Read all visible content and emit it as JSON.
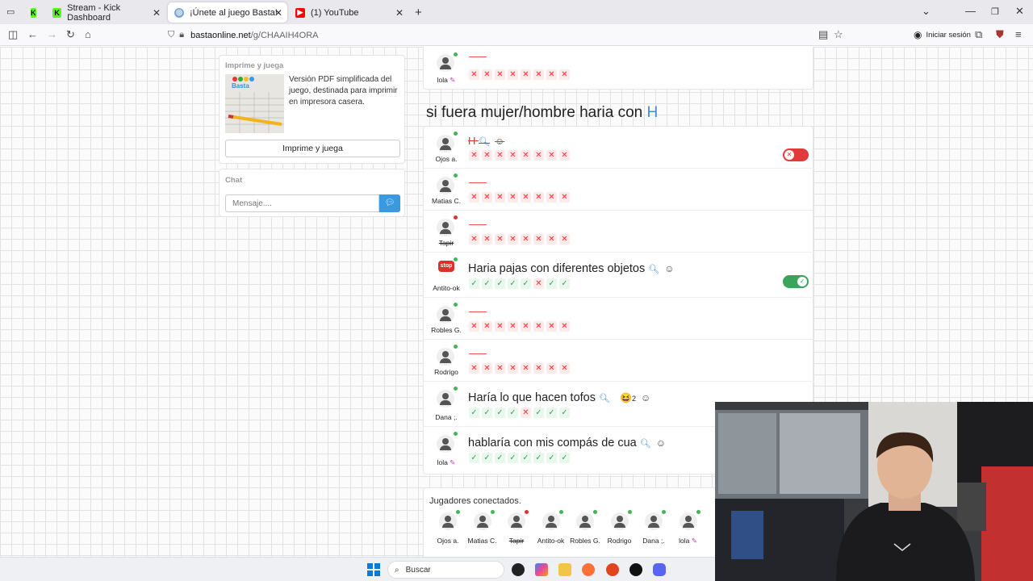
{
  "browser": {
    "tabs": [
      {
        "label": ""
      },
      {
        "label": "Stream - Kick Dashboard"
      },
      {
        "label": "¡Únete al juego Basta!"
      },
      {
        "label": "(1) YouTube"
      }
    ],
    "url_domain": "bastaonline.net",
    "url_path": "/g/CHAAIH4ORA",
    "sign_in": "Iniciar sesión"
  },
  "print_panel": {
    "title": "Imprime y juega",
    "description": "Versión PDF simplificada del juego, destinada para imprimir en impresora casera.",
    "button": "Imprime y juega"
  },
  "chat": {
    "title": "Chat",
    "placeholder": "Mensaje...."
  },
  "prev_round": {
    "player": "lola",
    "votes": [
      "x",
      "x",
      "x",
      "x",
      "x",
      "x",
      "x",
      "x"
    ]
  },
  "topic": {
    "text": "si fuera mujer/hombre haria con",
    "letter": "H"
  },
  "answers": [
    {
      "player": "Ojos a.",
      "answer": "H",
      "invalid": true,
      "status": "green",
      "toggle": "off",
      "votes": [
        "x",
        "x",
        "x",
        "x",
        "x",
        "x",
        "x",
        "x"
      ]
    },
    {
      "player": "Matias C.",
      "answer": "",
      "status": "green",
      "votes": [
        "x",
        "x",
        "x",
        "x",
        "x",
        "x",
        "x",
        "x"
      ]
    },
    {
      "player": "Tapir",
      "answer": "",
      "status": "red",
      "strike": true,
      "votes": [
        "x",
        "x",
        "x",
        "x",
        "x",
        "x",
        "x",
        "x"
      ]
    },
    {
      "player": "Antito-ok",
      "answer": "Haria pajas con diferentes objetos",
      "status": "green",
      "toggle": "on",
      "votes": [
        "ok",
        "ok",
        "ok",
        "ok",
        "ok",
        "x",
        "ok",
        "ok"
      ]
    },
    {
      "player": "Robles G.",
      "answer": "",
      "status": "green",
      "votes": [
        "x",
        "x",
        "x",
        "x",
        "x",
        "x",
        "x",
        "x"
      ]
    },
    {
      "player": "Rodrigo",
      "answer": "",
      "status": "green",
      "votes": [
        "x",
        "x",
        "x",
        "x",
        "x",
        "x",
        "x",
        "x"
      ]
    },
    {
      "player": "Dana ;.",
      "answer": "Haría lo que hacen tofos",
      "status": "green",
      "reaction": "😆",
      "reaction_count": "2",
      "votes": [
        "ok",
        "ok",
        "ok",
        "ok",
        "x",
        "ok",
        "ok",
        "ok"
      ]
    },
    {
      "player": "lola",
      "answer": "hablaría con mis compás de cua",
      "status": "green",
      "votes": [
        "ok",
        "ok",
        "ok",
        "ok",
        "ok",
        "ok",
        "ok",
        "ok"
      ]
    }
  ],
  "connected": {
    "title": "Jugadores conectados.",
    "players": [
      "Ojos a.",
      "Matias C.",
      "Tapir",
      "Antito-ok",
      "Robles G.",
      "Rodrigo",
      "Dana ;.",
      "lola"
    ]
  },
  "taskbar": {
    "search": "Buscar"
  }
}
